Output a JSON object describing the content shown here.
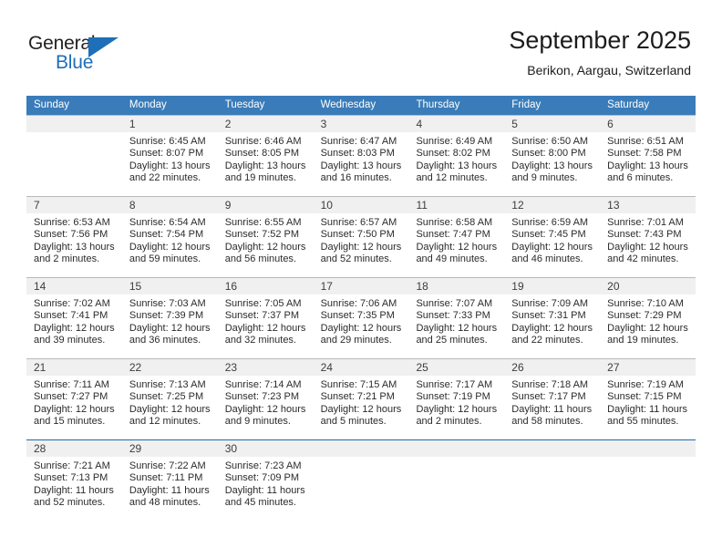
{
  "brand": {
    "name_part1": "General",
    "name_part2": "Blue",
    "triangle_icon": "triangle-icon",
    "accent_color": "#1d6fb8"
  },
  "header": {
    "title": "September 2025",
    "subtitle": "Berikon, Aargau, Switzerland"
  },
  "theme": {
    "header_bar": "#3a7cba",
    "date_strip": "#f0f0f0",
    "rule": "#1f6cb0",
    "grid_line": "#b9b9b9",
    "text": "#2b2b2b"
  },
  "weekdays": [
    "Sunday",
    "Monday",
    "Tuesday",
    "Wednesday",
    "Thursday",
    "Friday",
    "Saturday"
  ],
  "weeks": [
    {
      "dates": [
        "",
        "1",
        "2",
        "3",
        "4",
        "5",
        "6"
      ],
      "cells": [
        {
          "lines": [
            "",
            "",
            "",
            ""
          ]
        },
        {
          "lines": [
            "Sunrise: 6:45 AM",
            "Sunset: 8:07 PM",
            "Daylight: 13 hours",
            "and 22 minutes."
          ]
        },
        {
          "lines": [
            "Sunrise: 6:46 AM",
            "Sunset: 8:05 PM",
            "Daylight: 13 hours",
            "and 19 minutes."
          ]
        },
        {
          "lines": [
            "Sunrise: 6:47 AM",
            "Sunset: 8:03 PM",
            "Daylight: 13 hours",
            "and 16 minutes."
          ]
        },
        {
          "lines": [
            "Sunrise: 6:49 AM",
            "Sunset: 8:02 PM",
            "Daylight: 13 hours",
            "and 12 minutes."
          ]
        },
        {
          "lines": [
            "Sunrise: 6:50 AM",
            "Sunset: 8:00 PM",
            "Daylight: 13 hours",
            "and 9 minutes."
          ]
        },
        {
          "lines": [
            "Sunrise: 6:51 AM",
            "Sunset: 7:58 PM",
            "Daylight: 13 hours",
            "and 6 minutes."
          ]
        }
      ]
    },
    {
      "dates": [
        "7",
        "8",
        "9",
        "10",
        "11",
        "12",
        "13"
      ],
      "cells": [
        {
          "lines": [
            "Sunrise: 6:53 AM",
            "Sunset: 7:56 PM",
            "Daylight: 13 hours",
            "and 2 minutes."
          ]
        },
        {
          "lines": [
            "Sunrise: 6:54 AM",
            "Sunset: 7:54 PM",
            "Daylight: 12 hours",
            "and 59 minutes."
          ]
        },
        {
          "lines": [
            "Sunrise: 6:55 AM",
            "Sunset: 7:52 PM",
            "Daylight: 12 hours",
            "and 56 minutes."
          ]
        },
        {
          "lines": [
            "Sunrise: 6:57 AM",
            "Sunset: 7:50 PM",
            "Daylight: 12 hours",
            "and 52 minutes."
          ]
        },
        {
          "lines": [
            "Sunrise: 6:58 AM",
            "Sunset: 7:47 PM",
            "Daylight: 12 hours",
            "and 49 minutes."
          ]
        },
        {
          "lines": [
            "Sunrise: 6:59 AM",
            "Sunset: 7:45 PM",
            "Daylight: 12 hours",
            "and 46 minutes."
          ]
        },
        {
          "lines": [
            "Sunrise: 7:01 AM",
            "Sunset: 7:43 PM",
            "Daylight: 12 hours",
            "and 42 minutes."
          ]
        }
      ]
    },
    {
      "dates": [
        "14",
        "15",
        "16",
        "17",
        "18",
        "19",
        "20"
      ],
      "cells": [
        {
          "lines": [
            "Sunrise: 7:02 AM",
            "Sunset: 7:41 PM",
            "Daylight: 12 hours",
            "and 39 minutes."
          ]
        },
        {
          "lines": [
            "Sunrise: 7:03 AM",
            "Sunset: 7:39 PM",
            "Daylight: 12 hours",
            "and 36 minutes."
          ]
        },
        {
          "lines": [
            "Sunrise: 7:05 AM",
            "Sunset: 7:37 PM",
            "Daylight: 12 hours",
            "and 32 minutes."
          ]
        },
        {
          "lines": [
            "Sunrise: 7:06 AM",
            "Sunset: 7:35 PM",
            "Daylight: 12 hours",
            "and 29 minutes."
          ]
        },
        {
          "lines": [
            "Sunrise: 7:07 AM",
            "Sunset: 7:33 PM",
            "Daylight: 12 hours",
            "and 25 minutes."
          ]
        },
        {
          "lines": [
            "Sunrise: 7:09 AM",
            "Sunset: 7:31 PM",
            "Daylight: 12 hours",
            "and 22 minutes."
          ]
        },
        {
          "lines": [
            "Sunrise: 7:10 AM",
            "Sunset: 7:29 PM",
            "Daylight: 12 hours",
            "and 19 minutes."
          ]
        }
      ]
    },
    {
      "dates": [
        "21",
        "22",
        "23",
        "24",
        "25",
        "26",
        "27"
      ],
      "cells": [
        {
          "lines": [
            "Sunrise: 7:11 AM",
            "Sunset: 7:27 PM",
            "Daylight: 12 hours",
            "and 15 minutes."
          ]
        },
        {
          "lines": [
            "Sunrise: 7:13 AM",
            "Sunset: 7:25 PM",
            "Daylight: 12 hours",
            "and 12 minutes."
          ]
        },
        {
          "lines": [
            "Sunrise: 7:14 AM",
            "Sunset: 7:23 PM",
            "Daylight: 12 hours",
            "and 9 minutes."
          ]
        },
        {
          "lines": [
            "Sunrise: 7:15 AM",
            "Sunset: 7:21 PM",
            "Daylight: 12 hours",
            "and 5 minutes."
          ]
        },
        {
          "lines": [
            "Sunrise: 7:17 AM",
            "Sunset: 7:19 PM",
            "Daylight: 12 hours",
            "and 2 minutes."
          ]
        },
        {
          "lines": [
            "Sunrise: 7:18 AM",
            "Sunset: 7:17 PM",
            "Daylight: 11 hours",
            "and 58 minutes."
          ]
        },
        {
          "lines": [
            "Sunrise: 7:19 AM",
            "Sunset: 7:15 PM",
            "Daylight: 11 hours",
            "and 55 minutes."
          ]
        }
      ]
    },
    {
      "dates": [
        "28",
        "29",
        "30",
        "",
        "",
        "",
        ""
      ],
      "cells": [
        {
          "lines": [
            "Sunrise: 7:21 AM",
            "Sunset: 7:13 PM",
            "Daylight: 11 hours",
            "and 52 minutes."
          ]
        },
        {
          "lines": [
            "Sunrise: 7:22 AM",
            "Sunset: 7:11 PM",
            "Daylight: 11 hours",
            "and 48 minutes."
          ]
        },
        {
          "lines": [
            "Sunrise: 7:23 AM",
            "Sunset: 7:09 PM",
            "Daylight: 11 hours",
            "and 45 minutes."
          ]
        },
        {
          "lines": [
            "",
            "",
            "",
            ""
          ]
        },
        {
          "lines": [
            "",
            "",
            "",
            ""
          ]
        },
        {
          "lines": [
            "",
            "",
            "",
            ""
          ]
        },
        {
          "lines": [
            "",
            "",
            "",
            ""
          ]
        }
      ]
    }
  ]
}
